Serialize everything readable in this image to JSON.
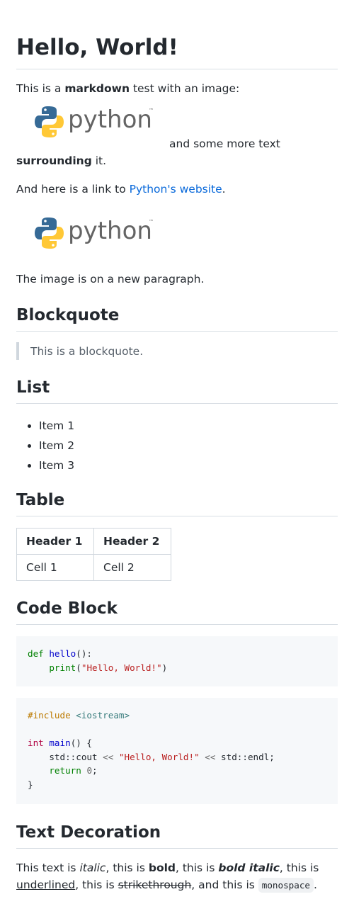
{
  "title": "Hello, World!",
  "intro": {
    "before_bold": "This is a ",
    "bold": "markdown",
    "after_bold": " test with an image:",
    "after_image": "and some more text",
    "bold2": "surrounding",
    "end": " it."
  },
  "link_paragraph": {
    "before": "And here is a link to ",
    "link_text": "Python's website",
    "after": "."
  },
  "logo_text": "python",
  "logo_tm": "™",
  "new_para_text": "The image is on a new paragraph.",
  "sections": {
    "blockquote": "Blockquote",
    "list": "List",
    "table": "Table",
    "code": "Code Block",
    "text_decoration": "Text Decoration"
  },
  "blockquote_text": "This is a blockquote.",
  "list_items": [
    "Item 1",
    "Item 2",
    "Item 3"
  ],
  "table": {
    "headers": [
      "Header 1",
      "Header 2"
    ],
    "rows": [
      [
        "Cell 1",
        "Cell 2"
      ]
    ]
  },
  "code_python": {
    "l1_kw": "def",
    "l1_fn": "hello",
    "l1_rest": "():",
    "l2_indent": "    ",
    "l2_fn": "print",
    "l2_open": "(",
    "l2_str": "\"Hello, World!\"",
    "l2_close": ")"
  },
  "code_cpp": {
    "include": "#include",
    "header": "<iostream>",
    "type": "int",
    "main": "main",
    "sig_rest": "() {",
    "indent": "    ",
    "cout": "std::cout ",
    "op": "<<",
    "str": "\"Hello, World!\"",
    "endl": "std::endl;",
    "ret": "return",
    "zero": "0",
    "semi": ";",
    "close": "}"
  },
  "decoration": {
    "t1": "This text is ",
    "italic": "italic",
    "t2": ", this is ",
    "bold": "bold",
    "t3": ", this is ",
    "bold_italic": "bold italic",
    "t4": ", this is",
    "underlined": "underlined",
    "t5": ", this is ",
    "strike": "strikethrough",
    "t6": ", and this is ",
    "mono": "monospace",
    "t7": "."
  },
  "colors": {
    "link": "#0969da",
    "rule": "#d8dee4",
    "code_bg": "#f6f8fa",
    "python_blue": "#366a96",
    "python_yellow": "#ffc836"
  }
}
